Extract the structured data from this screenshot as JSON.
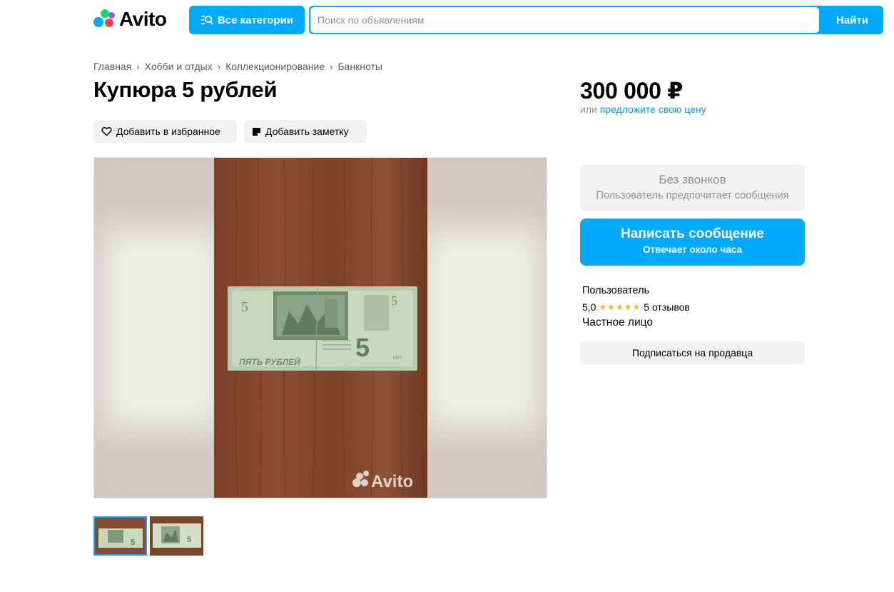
{
  "header": {
    "logo_text": "Avito",
    "categories_label": "Все категории",
    "search": {
      "placeholder": "Поиск по объявлениям",
      "value": ""
    },
    "search_button": "Найти"
  },
  "breadcrumb": [
    "Главная",
    "Хобби и отдых",
    "Коллекционирование",
    "Банкноты"
  ],
  "listing": {
    "title": "Купюра 5 рублей",
    "actions": {
      "favorite": "Добавить в избранное",
      "note": "Добавить заметку"
    },
    "gallery": {
      "watermark": "Avito",
      "thumbnails": 2,
      "selected_thumbnail": 1
    },
    "banknote": {
      "numeral": "5",
      "text": "ПЯТЬ РУБЛЕЙ",
      "year": "1997"
    }
  },
  "sidebar": {
    "price": "300 000 ₽",
    "offer_prefix": "или",
    "offer_link": "предложите свою цену",
    "no_calls_title": "Без звонков",
    "no_calls_sub": "Пользователь предпочитает сообщения",
    "message_button": "Написать сообщение",
    "message_sub": "Отвечает около часа",
    "seller_name": "Пользователь",
    "rating_value": "5,0",
    "rating_stars": "★★★★★",
    "reviews": "5 отзывов",
    "seller_type": "Частное лицо",
    "subscribe_button": "Подписаться на продавца"
  },
  "colors": {
    "accent": "#00aaff",
    "chip_bg": "#f2f1f0",
    "link": "#0099f7",
    "star": "#ffb021"
  }
}
